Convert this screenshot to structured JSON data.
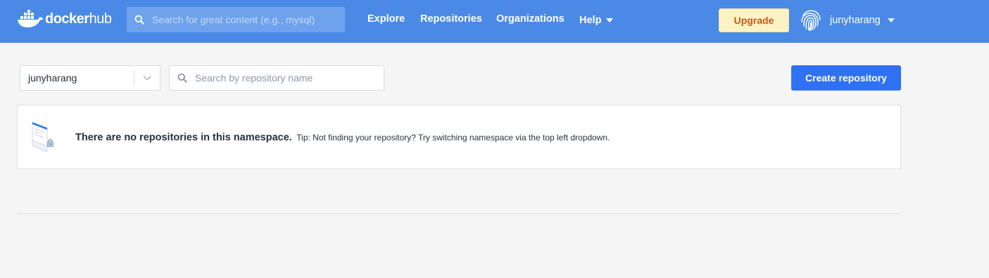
{
  "header": {
    "logo": {
      "word1": "docker",
      "word2": "hub"
    },
    "search_placeholder": "Search for great content (e.g., mysql)",
    "nav": {
      "explore": "Explore",
      "repositories": "Repositories",
      "organizations": "Organizations",
      "help": "Help"
    },
    "upgrade_label": "Upgrade",
    "username": "junyharang"
  },
  "controls": {
    "namespace": "junyharang",
    "repo_search_placeholder": "Search by repository name",
    "create_label": "Create repository"
  },
  "empty_state": {
    "title": "There are no repositories in this namespace.",
    "tip": "Tip: Not finding your repository? Try switching namespace via the top left dropdown."
  },
  "colors": {
    "header_bg": "#4a8ae6",
    "primary_button": "#2e71f2",
    "upgrade_bg": "#fdf2c3",
    "upgrade_text": "#c4571d",
    "page_bg": "#f5f5f5"
  },
  "icons": [
    "docker-whale-icon",
    "search-icon",
    "chevron-down-icon",
    "fingerprint-avatar-icon",
    "empty-repo-illustration"
  ]
}
